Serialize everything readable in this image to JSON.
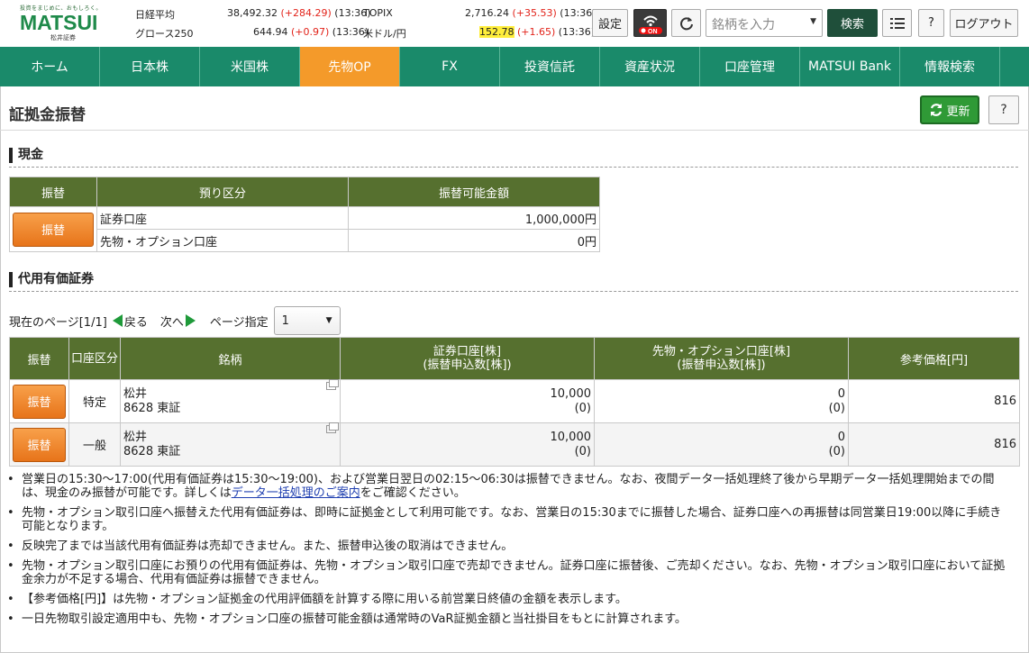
{
  "header": {
    "logo_tagline": "投資をまじめに、おもしろく。",
    "logo_name": "MATSUI",
    "logo_sub": "松井証券",
    "markets": [
      {
        "name": "日経平均",
        "value": "38,492.32",
        "change": "(+284.29)",
        "time": "(13:36)"
      },
      {
        "name": "TOPIX",
        "value": "2,716.24",
        "change": "(+35.53)",
        "time": "(13:36)"
      },
      {
        "name": "グロース250",
        "value": "644.94",
        "change": "(+0.97)",
        "time": "(13:36)"
      },
      {
        "name": "米ドル/円",
        "value": "152.78",
        "change": "(+1.65)",
        "time": "(13:36)"
      }
    ],
    "settings_label": "設定",
    "on_label": "ON",
    "search_placeholder": "銘柄を入力",
    "search_label": "検索",
    "help_label": "?",
    "logout_label": "ログアウト"
  },
  "nav": {
    "items": [
      "ホーム",
      "日本株",
      "米国株",
      "先物OP",
      "FX",
      "投資信託",
      "資産状況",
      "口座管理",
      "MATSUI Bank",
      "情報検索"
    ],
    "active_index": 3
  },
  "page": {
    "title": "証拠金振替",
    "refresh_label": "更新",
    "help_label": "?"
  },
  "cash": {
    "section_title": "現金",
    "headers": [
      "振替",
      "預り区分",
      "振替可能金額"
    ],
    "transfer_label": "振替",
    "rows": [
      {
        "account": "証券口座",
        "amount": "1,000,000円"
      },
      {
        "account": "先物・オプション口座",
        "amount": "0円"
      }
    ]
  },
  "securities": {
    "section_title": "代用有価証券",
    "pager": {
      "current_label": "現在のページ[1/1]",
      "prev_label": "戻る",
      "next_label": "次へ",
      "page_select_label": "ページ指定",
      "page_value": "1"
    },
    "headers": [
      "振替",
      "口座区分",
      "銘柄",
      "証券口座[株]",
      "(振替申込数[株])",
      "先物・オプション口座[株]",
      "(振替申込数[株])",
      "参考価格[円]"
    ],
    "rows": [
      {
        "transfer": "振替",
        "account_type": "特定",
        "name": "松井",
        "code": "8628 東証",
        "sec_qty": "10,000",
        "sec_req": "(0)",
        "fut_qty": "0",
        "fut_req": "(0)",
        "price": "816"
      },
      {
        "transfer": "振替",
        "account_type": "一般",
        "name": "松井",
        "code": "8628 東証",
        "sec_qty": "10,000",
        "sec_req": "(0)",
        "fut_qty": "0",
        "fut_req": "(0)",
        "price": "816"
      }
    ]
  },
  "notes": {
    "n1_a": "営業日の15:30～17:00(代用有価証券は15:30～19:00)、および営業日翌日の02:15～06:30は振替できません。なお、夜間データ一括処理終了後から早期データ一括処理開始までの間は、現金のみ振替が可能です。詳しくは",
    "n1_link": "データ一括処理のご案内",
    "n1_b": "をご確認ください。",
    "n2": "先物・オプション取引口座へ振替えた代用有価証券は、即時に証拠金として利用可能です。なお、営業日の15:30までに振替した場合、証券口座への再振替は同営業日19:00以降に手続き可能となります。",
    "n3": "反映完了までは当該代用有価証券は売却できません。また、振替申込後の取消はできません。",
    "n4": "先物・オプション取引口座にお預りの代用有価証券は、先物・オプション取引口座で売却できません。証券口座に振替後、ご売却ください。なお、先物・オプション取引口座において証拠金余力が不足する場合、代用有価証券は振替できません。",
    "n5": "【参考価格[円]】は先物・オプション証拠金の代用評価額を計算する際に用いる前営業日終値の金額を表示します。",
    "n6": "一日先物取引設定適用中も、先物・オプション口座の振替可能金額は通常時のVaR証拠金額と当社掛目をもとに計算されます。"
  },
  "colors": {
    "nav": "#1a8a6a",
    "nav_active": "#f49a2a",
    "table_header": "#56702f",
    "transfer_button": "#e7741a",
    "refresh_button": "#2f9a36",
    "price_up": "#e2231a"
  }
}
